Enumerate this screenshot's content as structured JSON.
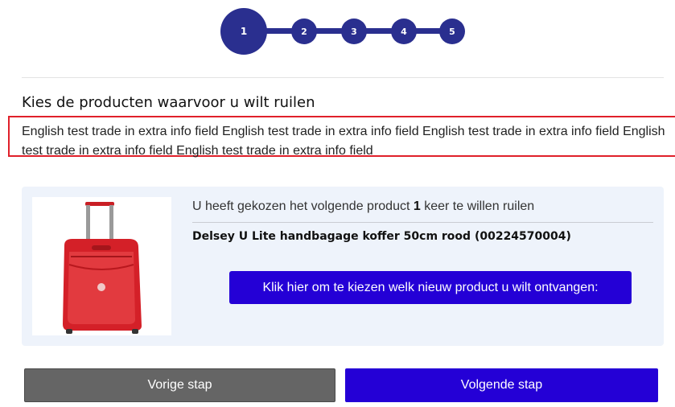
{
  "stepper": {
    "steps": [
      "1",
      "2",
      "3",
      "4",
      "5"
    ],
    "active_step": 1,
    "color": "#2a2f8f"
  },
  "page": {
    "heading": "Kies de producten waarvoor u wilt ruilen",
    "info_text": "English test trade in extra info field English test trade in extra info field English test trade in extra info field English test trade in extra info field English test trade in extra info field"
  },
  "product": {
    "selection_prefix": "U heeft gekozen het volgende product ",
    "quantity": "1",
    "selection_suffix": " keer te willen ruilen",
    "name": "Delsey U Lite handbagage koffer 50cm rood (00224570004)",
    "image_icon": "red-suitcase",
    "choose_button": "Klik hier om te kiezen welk nieuw product u wilt ontvangen:"
  },
  "navigation": {
    "previous": "Vorige stap",
    "next": "Volgende stap"
  },
  "colors": {
    "primary": "#2400d6",
    "secondary": "#656565",
    "highlight_border": "#e0202a",
    "card_background": "#eef3fb"
  }
}
